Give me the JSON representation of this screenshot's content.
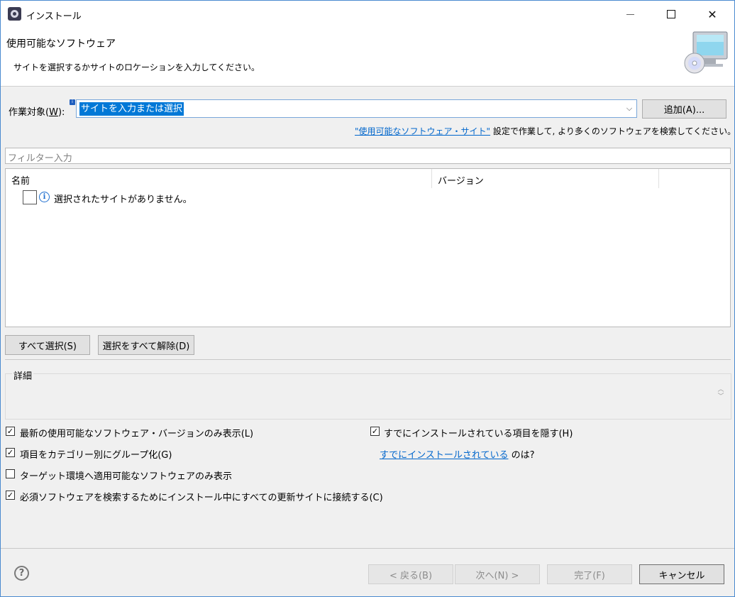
{
  "window": {
    "title": "インストール"
  },
  "header": {
    "title": "使用可能なソフトウェア",
    "description": "サイトを選択するかサイトのロケーションを入力してください。"
  },
  "work_with": {
    "label": "作業対象(",
    "mnemonic": "W",
    "label_end": "):",
    "value": "サイトを入力または選択",
    "add_button": "追加(A)..."
  },
  "note": {
    "link": "\"使用可能なソフトウェア・サイト\"",
    "text": " 設定で作業して, より多くのソフトウェアを検索してください。"
  },
  "filter": {
    "placeholder": "フィルター入力"
  },
  "tree": {
    "columns": [
      "名前",
      "バージョン"
    ],
    "rows": [
      {
        "text": "選択されたサイトがありません。",
        "checked": false
      }
    ]
  },
  "selection_buttons": {
    "select_all": "すべて選択(S)",
    "deselect_all": "選択をすべて解除(D)"
  },
  "details": {
    "title": "詳細"
  },
  "options": {
    "latest_only": {
      "label": "最新の使用可能なソフトウェア・バージョンのみ表示(L)",
      "checked": true
    },
    "group_by_category": {
      "label": "項目をカテゴリー別にグループ化(G)",
      "checked": true
    },
    "target_env_only": {
      "label": "ターゲット環境へ適用可能なソフトウェアのみ表示",
      "checked": false
    },
    "contact_all_sites": {
      "label": "必須ソフトウェアを検索するためにインストール中にすべての更新サイトに接続する(C)",
      "checked": true
    },
    "hide_installed": {
      "label": "すでにインストールされている項目を隠す(H)",
      "checked": true
    },
    "already_installed_link": "すでにインストールされている",
    "already_installed_suffix": " のは?"
  },
  "footer": {
    "back": "< 戻る(B)",
    "next": "次へ(N) >",
    "finish": "完了(F)",
    "cancel": "キャンセル"
  }
}
